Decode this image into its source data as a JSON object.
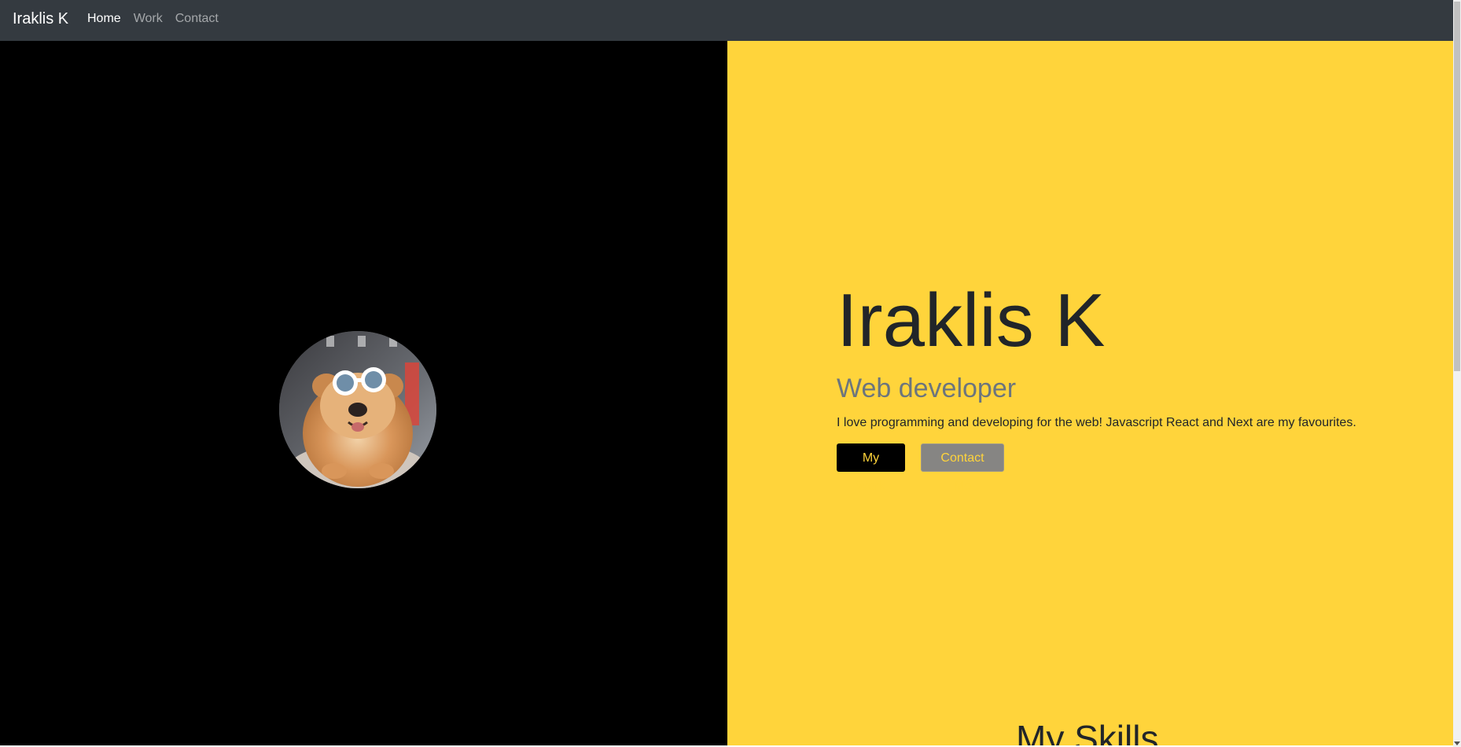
{
  "navbar": {
    "brand": "Iraklis K",
    "links": [
      {
        "label": "Home",
        "active": true
      },
      {
        "label": "Work",
        "active": false
      },
      {
        "label": "Contact",
        "active": false
      }
    ]
  },
  "hero": {
    "title": "Iraklis K",
    "subtitle": "Web developer",
    "description": "I love programming and developing for the web! Javascript React and Next are my favourites.",
    "buttons": {
      "work_label": "My Work",
      "contact_label": "Contact Me"
    },
    "avatar_alt": "dog-with-sunglasses-photo"
  },
  "skills": {
    "heading": "My Skills"
  },
  "colors": {
    "navbar_bg": "#343a40",
    "left_panel_bg": "#000000",
    "right_panel_bg": "#ffd43b",
    "accent_text": "#ffd43b",
    "subtitle": "#6c757d"
  }
}
